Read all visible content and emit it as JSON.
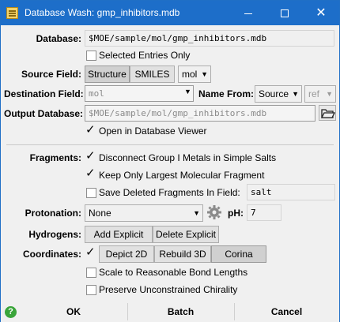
{
  "window": {
    "title": "Database Wash: gmp_inhibitors.mdb"
  },
  "database": {
    "label": "Database:",
    "value": "$MOE/sample/mol/gmp_inhibitors.mdb"
  },
  "selected_entries": {
    "label": "Selected Entries Only",
    "checked": false
  },
  "source_field": {
    "label": "Source Field:",
    "buttons": [
      "Structure",
      "SMILES"
    ],
    "combo": "mol"
  },
  "destination_field": {
    "label": "Destination Field:",
    "placeholder": "mol",
    "name_from_label": "Name From:",
    "name_from": "Source",
    "ref": "ref"
  },
  "output_database": {
    "label": "Output Database:",
    "placeholder": "$MOE/sample/mol/gmp_inhibitors.mdb"
  },
  "open_in_viewer": {
    "label": "Open in Database Viewer",
    "checked": true
  },
  "fragments": {
    "label": "Fragments:",
    "disconnect": {
      "label": "Disconnect Group I Metals in Simple Salts",
      "checked": true
    },
    "keep_largest": {
      "label": "Keep Only Largest Molecular Fragment",
      "checked": true
    },
    "save_deleted": {
      "label": "Save Deleted Fragments In Field:",
      "checked": false,
      "field": "salt"
    }
  },
  "protonation": {
    "label": "Protonation:",
    "value": "None",
    "ph_label": "pH:",
    "ph": "7"
  },
  "hydrogens": {
    "label": "Hydrogens:",
    "buttons": [
      "Add Explicit",
      "Delete Explicit"
    ]
  },
  "coordinates": {
    "label": "Coordinates:",
    "checked": true,
    "buttons": [
      "Depict 2D",
      "Rebuild 3D",
      "Corina"
    ],
    "scale": {
      "label": "Scale to Reasonable Bond Lengths",
      "checked": false
    },
    "preserve": {
      "label": "Preserve Unconstrained Chirality",
      "checked": false
    }
  },
  "footer": {
    "help": "?",
    "ok": "OK",
    "batch": "Batch",
    "cancel": "Cancel"
  }
}
